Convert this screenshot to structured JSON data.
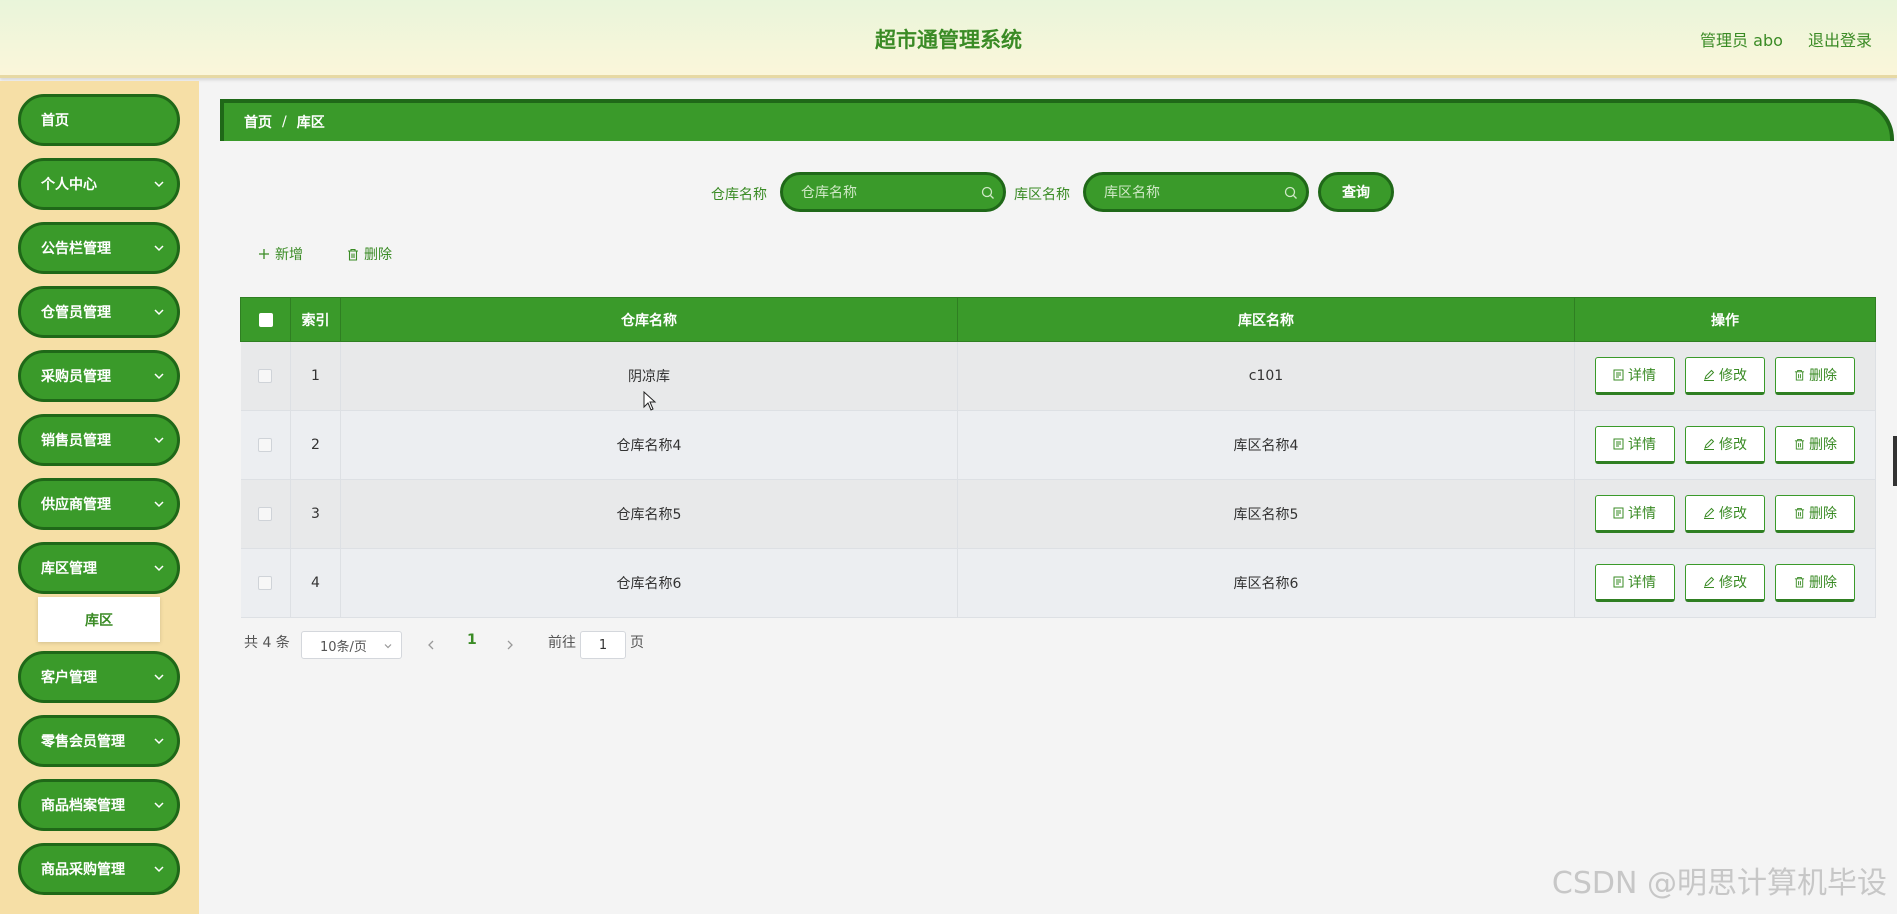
{
  "header": {
    "title": "超市通管理系统",
    "user_label": "管理员 abo",
    "logout": "退出登录"
  },
  "sidebar": {
    "items": [
      {
        "label": "首页"
      },
      {
        "label": "个人中心"
      },
      {
        "label": "公告栏管理"
      },
      {
        "label": "仓管员管理"
      },
      {
        "label": "采购员管理"
      },
      {
        "label": "销售员管理"
      },
      {
        "label": "供应商管理"
      },
      {
        "label": "库区管理"
      },
      {
        "label": "客户管理"
      },
      {
        "label": "零售会员管理"
      },
      {
        "label": "商品档案管理"
      },
      {
        "label": "商品采购管理"
      }
    ],
    "submenu_label": "库区"
  },
  "breadcrumb": {
    "home": "首页",
    "sep": "/",
    "current": "库区"
  },
  "search": {
    "warehouse_label": "仓库名称",
    "warehouse_placeholder": "仓库名称",
    "zone_label": "库区名称",
    "zone_placeholder": "库区名称",
    "query_button": "查询"
  },
  "actions": {
    "add": "新增",
    "delete": "删除"
  },
  "table": {
    "columns": [
      "索引",
      "仓库名称",
      "库区名称",
      "操作"
    ],
    "rows": [
      {
        "index": "1",
        "warehouse": "阴凉库",
        "zone": "c101"
      },
      {
        "index": "2",
        "warehouse": "仓库名称4",
        "zone": "库区名称4"
      },
      {
        "index": "3",
        "warehouse": "仓库名称5",
        "zone": "库区名称5"
      },
      {
        "index": "4",
        "warehouse": "仓库名称6",
        "zone": "库区名称6"
      }
    ],
    "op_detail": "详情",
    "op_edit": "修改",
    "op_delete": "删除"
  },
  "pagination": {
    "total": "共 4 条",
    "page_size": "10条/页",
    "current_page": "1",
    "goto_label": "前往",
    "goto_value": "1",
    "page_unit": "页"
  },
  "watermark": "CSDN @明思计算机毕设",
  "colors": {
    "primary_green": "#3a9a2a",
    "dark_green": "#1f6818",
    "sidebar_bg": "#f6dfa6",
    "header_bg": "#eef6dc"
  }
}
